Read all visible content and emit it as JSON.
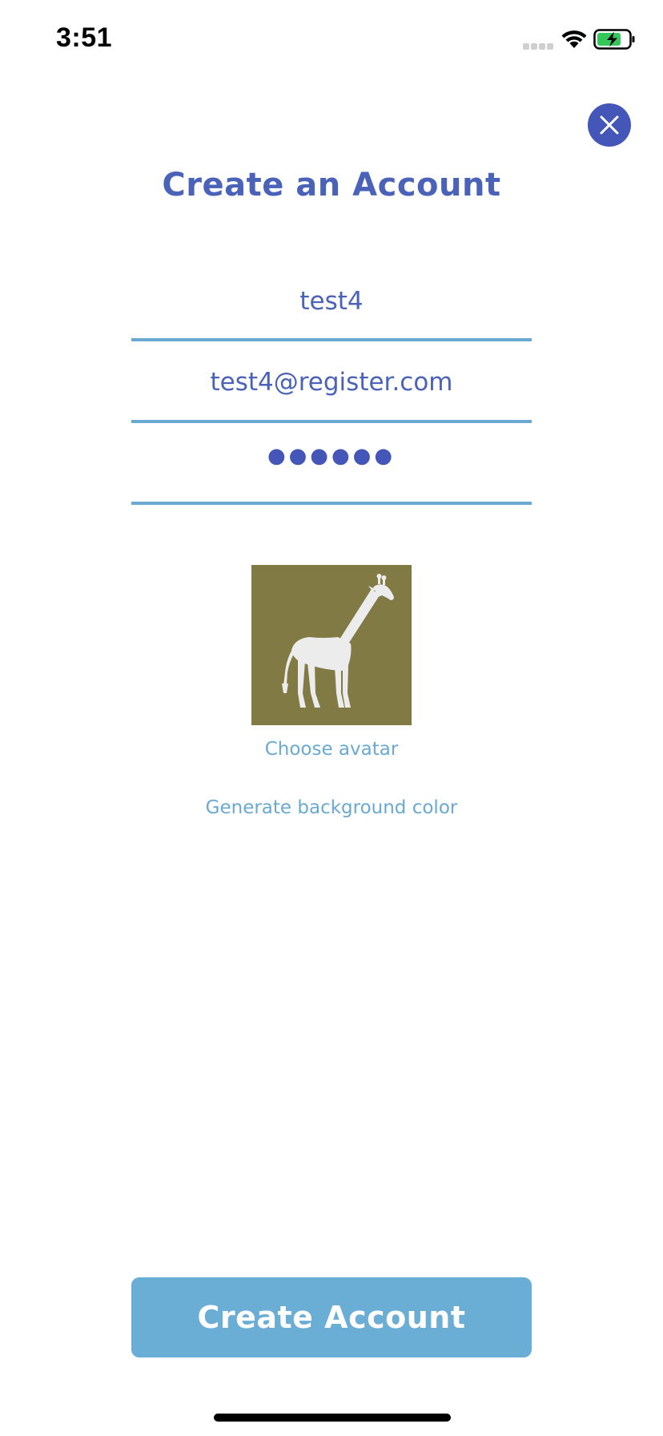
{
  "status_bar": {
    "time": "3:51",
    "signal_icon": "cellular-signal-icon",
    "wifi_icon": "wifi-icon",
    "battery_icon": "battery-charging-icon",
    "battery_level": 0.75,
    "battery_color": "#34c759"
  },
  "header": {
    "title": "Create an Account",
    "close_icon": "close-icon"
  },
  "form": {
    "username_value": "test4",
    "email_value": "test4@register.com",
    "password_masked": "●●●●●●",
    "password_length": 6
  },
  "avatar": {
    "icon": "giraffe-icon",
    "background_color": "#817a45",
    "choose_label": "Choose avatar",
    "generate_color_label": "Generate background color"
  },
  "actions": {
    "create_account_label": "Create Account"
  },
  "colors": {
    "accent": "#4a62b8",
    "close_button": "#4456b8",
    "line": "#6aa9d2",
    "primary_button": "#6aaed5"
  }
}
